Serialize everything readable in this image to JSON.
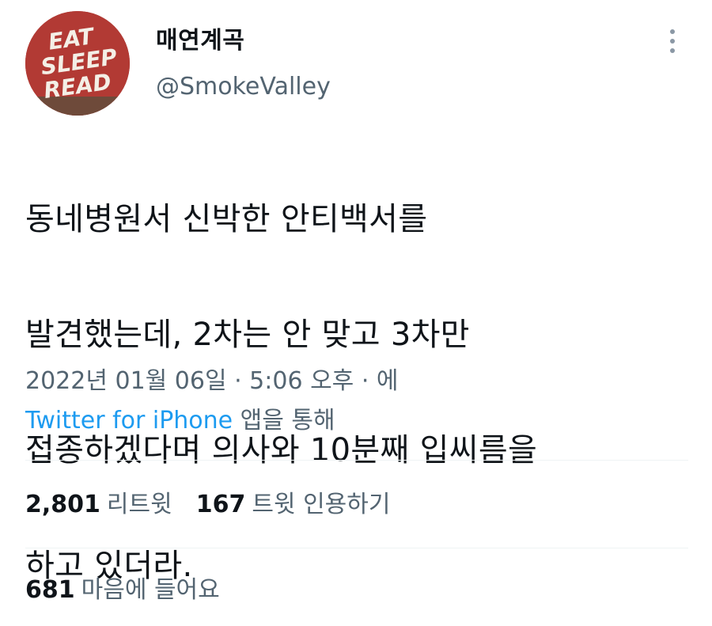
{
  "user": {
    "display_name": "매연계곡",
    "handle": "@SmokeValley",
    "avatar": {
      "text_lines": [
        "EAT",
        "SLEEP",
        "READ"
      ],
      "bg_color": "#b23a34"
    }
  },
  "more_icon": "more-vertical-icon",
  "tweet": {
    "lines": [
      "동네병원서 신박한 안티백서를",
      "발견했는데, 2차는 안 맞고 3차만",
      "접종하겠다며 의사와 10분째 입씨름을",
      "하고 있더라."
    ]
  },
  "meta": {
    "timestamp": "2022년 01월 06일 · 5:06 오후 · 에",
    "source_link": "Twitter for iPhone",
    "source_suffix": " 앱을 통해"
  },
  "stats": {
    "retweets_count": "2,801",
    "retweets_label": "리트윗",
    "quotes_count": "167",
    "quotes_label": "트윗 인용하기",
    "likes_count": "681",
    "likes_label": "마음에 들어요"
  },
  "colors": {
    "accent": "#1d9bf0",
    "secondary_text": "#536471",
    "primary_text": "#0f1419"
  }
}
